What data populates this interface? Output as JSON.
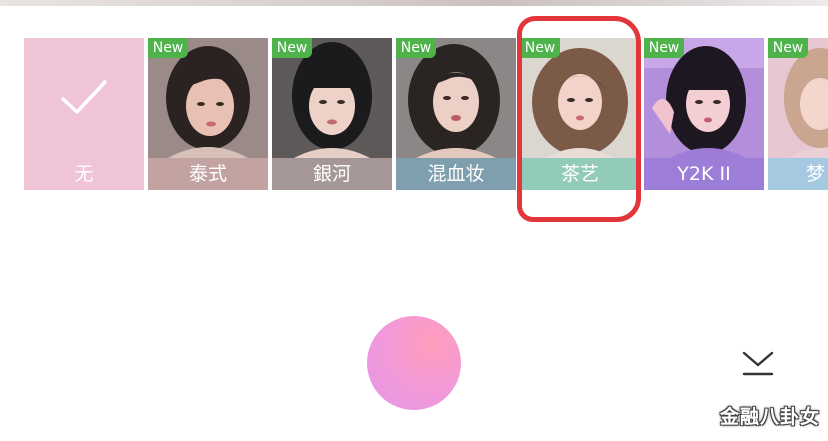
{
  "filters": [
    {
      "label": "无",
      "is_new": false,
      "selected": false,
      "label_bg": "#f0c4d7",
      "thumb_bg": "#f0c4d7"
    },
    {
      "label": "泰式",
      "is_new": true,
      "selected": false,
      "label_bg": "#c3a3a2",
      "thumb_bg": "#8a7a78",
      "hair": "#2b2222",
      "skin": "#e9c1b4"
    },
    {
      "label": "銀河",
      "is_new": true,
      "selected": false,
      "label_bg": "#a59697",
      "thumb_bg": "#6d6767",
      "hair": "#1b1a1c",
      "skin": "#efd2c7"
    },
    {
      "label": "混血妆",
      "is_new": true,
      "selected": false,
      "label_bg": "#7f9eae",
      "thumb_bg": "#8d8686",
      "hair": "#2a2423",
      "skin": "#eccfc5"
    },
    {
      "label": "茶艺",
      "is_new": true,
      "selected": true,
      "label_bg": "#93cbbb",
      "thumb_bg": "#dcd6d1",
      "hair": "#7b5a48",
      "skin": "#f1d3c9"
    },
    {
      "label": "Y2K II",
      "is_new": true,
      "selected": false,
      "label_bg": "#9c7ed8",
      "thumb_bg": "#b38fdb",
      "hair": "#1c1720",
      "skin": "#f3cfd3"
    },
    {
      "label": "梦",
      "is_new": true,
      "selected": false,
      "label_bg": "#a6c9e2",
      "thumb_bg": "#e7c7d2",
      "hair": "#caa58f",
      "skin": "#f3d6cc"
    }
  ],
  "badge_text": "New",
  "icons": {
    "checkmark": "check-icon",
    "collapse": "chevron-down-icon"
  },
  "watermark": "金融八卦女",
  "colors": {
    "annotation": "#e2363a",
    "badge": "#4eb34b"
  }
}
